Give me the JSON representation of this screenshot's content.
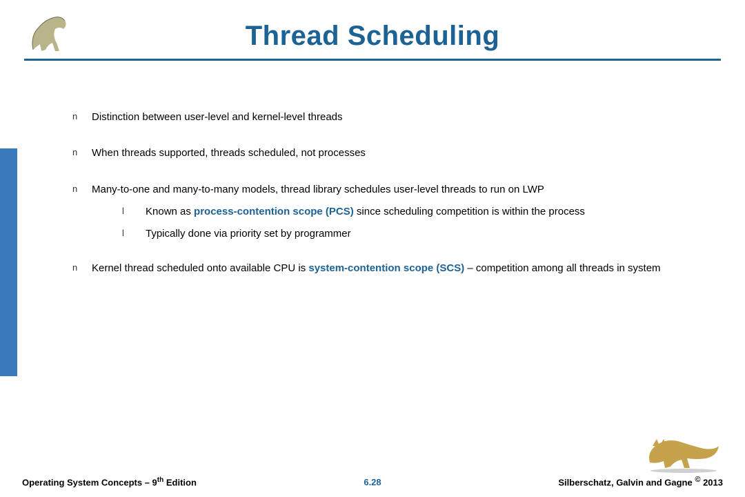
{
  "title": "Thread Scheduling",
  "bullets": {
    "b1": "Distinction between user-level and kernel-level threads",
    "b2": "When threads supported, threads scheduled, not processes",
    "b3_pre": "Many-to-one and many-to-many models, thread library schedules user-level threads to run on LWP",
    "b3a_pre": "Known as ",
    "b3a_term": "process-contention scope (PCS)",
    "b3a_post": " since scheduling competition is within the process",
    "b3b": "Typically done via priority set by programmer",
    "b4_pre": "Kernel thread scheduled onto available CPU is ",
    "b4_term": "system-contention scope (SCS)",
    "b4_post": " – competition among all threads in system"
  },
  "glyphs": {
    "lvl1": "n",
    "lvl2": "l"
  },
  "footer": {
    "left_a": "Operating System Concepts – 9",
    "left_sup": "th",
    "left_b": " Edition",
    "center": "6.28",
    "right_a": "Silberschatz, Galvin and Gagne ",
    "right_c": "©",
    "right_b": " 2013"
  }
}
